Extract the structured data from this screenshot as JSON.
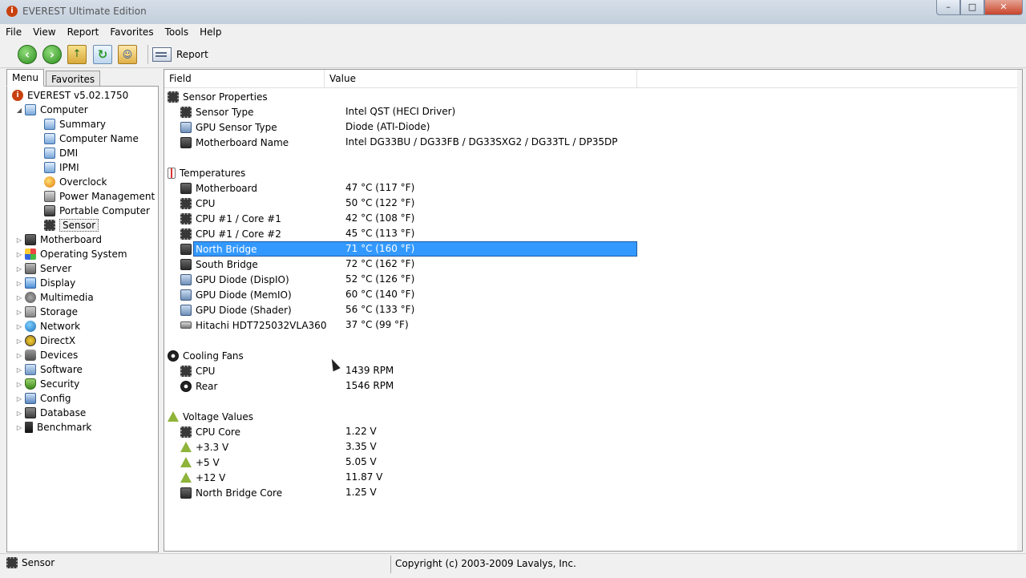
{
  "window": {
    "title": "EVEREST Ultimate Edition",
    "buttons": {
      "min": "–",
      "max": "□",
      "close": "✕"
    }
  },
  "menubar": [
    "File",
    "View",
    "Report",
    "Favorites",
    "Tools",
    "Help"
  ],
  "toolbar": {
    "report_label": "Report"
  },
  "tabs": {
    "menu": "Menu",
    "favorites": "Favorites"
  },
  "tree": {
    "root": "EVEREST v5.02.1750",
    "computer": "Computer",
    "computer_children": [
      "Summary",
      "Computer Name",
      "DMI",
      "IPMI",
      "Overclock",
      "Power Management",
      "Portable Computer",
      "Sensor"
    ],
    "categories": [
      "Motherboard",
      "Operating System",
      "Server",
      "Display",
      "Multimedia",
      "Storage",
      "Network",
      "DirectX",
      "Devices",
      "Software",
      "Security",
      "Config",
      "Database",
      "Benchmark"
    ]
  },
  "columns": {
    "field": "Field",
    "value": "Value"
  },
  "sections": [
    {
      "title": "Sensor Properties",
      "icon": "chip-icon",
      "items": [
        {
          "field": "Sensor Type",
          "value": "Intel QST  (HECI Driver)",
          "icon": "chip-icon"
        },
        {
          "field": "GPU Sensor Type",
          "value": "Diode  (ATI-Diode)",
          "icon": "gpu-icon"
        },
        {
          "field": "Motherboard Name",
          "value": "Intel DG33BU / DG33FB / DG33SXG2 / DG33TL / DP35DP",
          "icon": "motherboard-icon"
        }
      ]
    },
    {
      "title": "Temperatures",
      "icon": "thermometer-icon",
      "items": [
        {
          "field": "Motherboard",
          "value": "47 °C  (117 °F)",
          "icon": "motherboard-icon"
        },
        {
          "field": "CPU",
          "value": "50 °C  (122 °F)",
          "icon": "cpu-icon"
        },
        {
          "field": "CPU #1 / Core #1",
          "value": "42 °C  (108 °F)",
          "icon": "cpu-icon"
        },
        {
          "field": "CPU #1 / Core #2",
          "value": "45 °C  (113 °F)",
          "icon": "cpu-icon"
        },
        {
          "field": "North Bridge",
          "value": "71 °C  (160 °F)",
          "icon": "chip-icon",
          "selected": true
        },
        {
          "field": "South Bridge",
          "value": "72 °C  (162 °F)",
          "icon": "chip-icon"
        },
        {
          "field": "GPU Diode (DispIO)",
          "value": "52 °C  (126 °F)",
          "icon": "gpu-icon"
        },
        {
          "field": "GPU Diode (MemIO)",
          "value": "60 °C  (140 °F)",
          "icon": "gpu-icon"
        },
        {
          "field": "GPU Diode (Shader)",
          "value": "56 °C  (133 °F)",
          "icon": "gpu-icon"
        },
        {
          "field": "Hitachi HDT725032VLA360",
          "value": "37 °C  (99 °F)",
          "icon": "hdd-icon"
        }
      ]
    },
    {
      "title": "Cooling Fans",
      "icon": "fan-icon",
      "items": [
        {
          "field": "CPU",
          "value": "1439 RPM",
          "icon": "cpu-icon"
        },
        {
          "field": "Rear",
          "value": "1546 RPM",
          "icon": "fan-icon"
        }
      ]
    },
    {
      "title": "Voltage Values",
      "icon": "voltage-icon",
      "items": [
        {
          "field": "CPU Core",
          "value": "1.22 V",
          "icon": "cpu-icon"
        },
        {
          "field": "+3.3 V",
          "value": "3.35 V",
          "icon": "voltage-icon"
        },
        {
          "field": "+5 V",
          "value": "5.05 V",
          "icon": "voltage-icon"
        },
        {
          "field": "+12 V",
          "value": "11.87 V",
          "icon": "voltage-icon"
        },
        {
          "field": "North Bridge Core",
          "value": "1.25 V",
          "icon": "chip-icon"
        }
      ]
    }
  ],
  "statusbar": {
    "left": "Sensor",
    "right": "Copyright (c) 2003-2009 Lavalys, Inc."
  }
}
